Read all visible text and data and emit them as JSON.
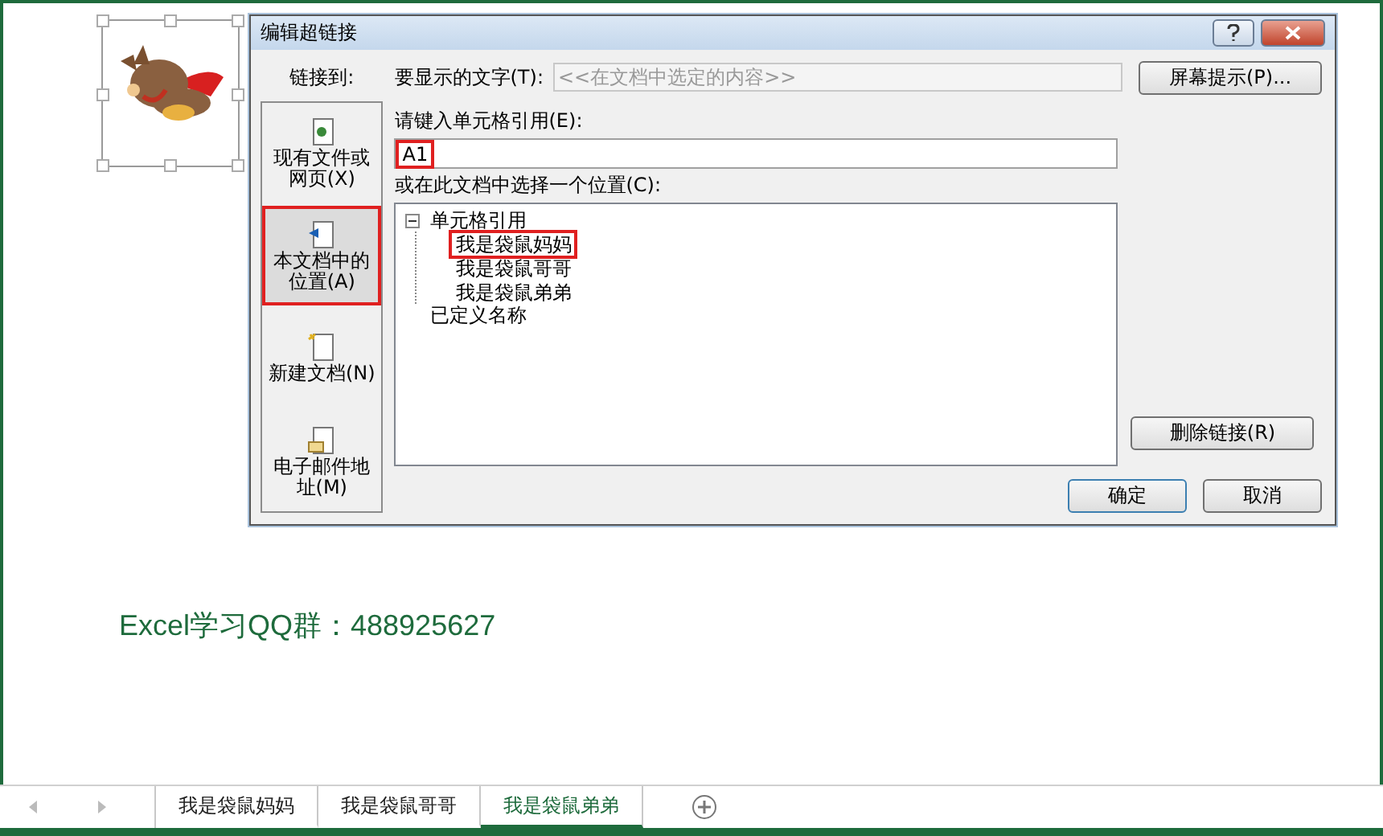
{
  "sheet": {
    "note": "Excel学习QQ群：488925627"
  },
  "dialog": {
    "title": "编辑超链接",
    "link_to_label": "链接到:",
    "link_targets": [
      {
        "kind": "file",
        "label": "现有文件或网页(X)",
        "selected": false,
        "highlighted": false
      },
      {
        "kind": "place",
        "label": "本文档中的位置(A)",
        "selected": true,
        "highlighted": true
      },
      {
        "kind": "new",
        "label": "新建文档(N)",
        "selected": false,
        "highlighted": false
      },
      {
        "kind": "mail",
        "label": "电子邮件地址(M)",
        "selected": false,
        "highlighted": false
      }
    ],
    "display_text": {
      "label": "要显示的文字(T):",
      "value": "<<在文档中选定的内容>>",
      "disabled": true
    },
    "screen_tip_button": "屏幕提示(P)...",
    "cell_ref": {
      "label": "请键入单元格引用(E):",
      "value": "A1",
      "highlighted": true
    },
    "place_label": "或在此文档中选择一个位置(C):",
    "tree": [
      {
        "label": "单元格引用",
        "expanded": true,
        "children": [
          {
            "label": "我是袋鼠妈妈",
            "selected": false,
            "highlighted": true
          },
          {
            "label": "我是袋鼠哥哥",
            "selected": false,
            "highlighted": false
          },
          {
            "label": "我是袋鼠弟弟",
            "selected": false,
            "highlighted": false
          }
        ]
      },
      {
        "label": "已定义名称"
      }
    ],
    "remove_link_button": "删除链接(R)",
    "ok_button": "确定",
    "cancel_button": "取消"
  },
  "sheet_tabs": [
    {
      "label": "我是袋鼠妈妈",
      "selected": false
    },
    {
      "label": "我是袋鼠哥哥",
      "selected": false
    },
    {
      "label": "我是袋鼠弟弟",
      "selected": true
    }
  ]
}
